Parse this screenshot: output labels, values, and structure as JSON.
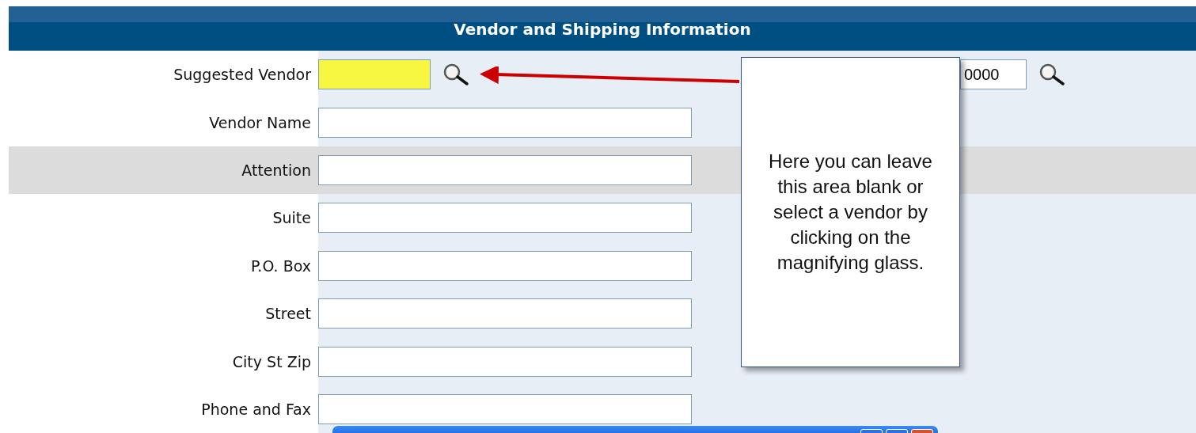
{
  "section": {
    "title": "Vendor and Shipping Information"
  },
  "rows": [
    {
      "label": "Suggested Vendor",
      "highlighted": true,
      "lookup": true,
      "shaded": false
    },
    {
      "label": "Vendor Name",
      "highlighted": false,
      "lookup": false,
      "shaded": false
    },
    {
      "label": "Attention",
      "highlighted": false,
      "lookup": false,
      "shaded": true
    },
    {
      "label": "Suite",
      "highlighted": false,
      "lookup": false,
      "shaded": false
    },
    {
      "label": "P.O. Box",
      "highlighted": false,
      "lookup": false,
      "shaded": false
    },
    {
      "label": "Street",
      "highlighted": false,
      "lookup": false,
      "shaded": false
    },
    {
      "label": "City St Zip",
      "highlighted": false,
      "lookup": false,
      "shaded": false
    },
    {
      "label": "Phone and Fax",
      "highlighted": false,
      "lookup": false,
      "shaded": false
    }
  ],
  "second_field": {
    "value": "0000"
  },
  "callout": {
    "text": "Here you can leave this area blank or select a vendor by clicking on the magnifying glass."
  }
}
